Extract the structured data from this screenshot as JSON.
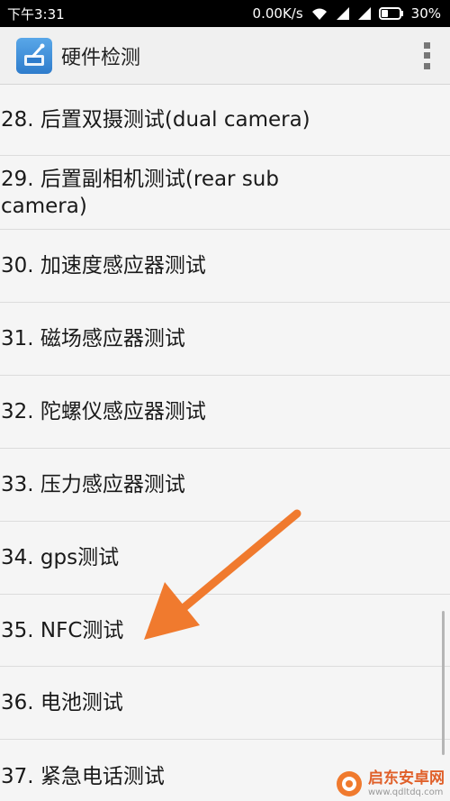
{
  "status_bar": {
    "time": "下午3:31",
    "network_speed": "0.00K/s",
    "battery_percent": "30%",
    "icons": [
      "wifi-icon",
      "signal-icon",
      "signal-icon",
      "battery-icon"
    ]
  },
  "app_bar": {
    "title": "硬件检测",
    "icon": "hardware-test-app-icon",
    "menu_icon": "overflow-menu-icon"
  },
  "list": {
    "items": [
      {
        "label": "28. 后置双摄测试(dual camera)"
      },
      {
        "label": "29. 后置副相机测试(rear sub camera)"
      },
      {
        "label": "30. 加速度感应器测试"
      },
      {
        "label": "31. 磁场感应器测试"
      },
      {
        "label": "32. 陀螺仪感应器测试"
      },
      {
        "label": "33. 压力感应器测试"
      },
      {
        "label": "34. gps测试"
      },
      {
        "label": "35. NFC测试"
      },
      {
        "label": "36. 电池测试"
      },
      {
        "label": "37. 紧急电话测试"
      }
    ]
  },
  "annotation": {
    "arrow_color": "#f07a2e",
    "points_to": "35. NFC测试"
  },
  "watermark": {
    "name": "启东安卓网",
    "url": "www.qdltdq.com"
  }
}
